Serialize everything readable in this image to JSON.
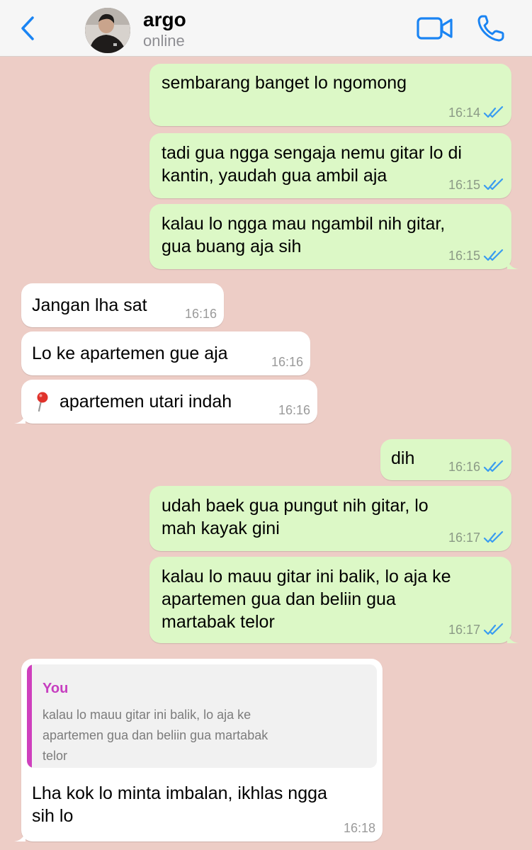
{
  "header": {
    "back_icon": "chevron-left-icon",
    "contact_name": "argo",
    "contact_status": "online",
    "video_icon": "video-camera-icon",
    "call_icon": "phone-icon",
    "accent_color": "#1a84f3"
  },
  "messages": [
    {
      "direction": "outgoing",
      "lines": [
        "sembarang banget lo ngomong"
      ],
      "time": "16:14",
      "status": "read"
    },
    {
      "direction": "outgoing",
      "lines": [
        "tadi gua ngga sengaja nemu gitar lo di",
        "kantin, yaudah gua ambil aja"
      ],
      "time": "16:15",
      "status": "read"
    },
    {
      "direction": "outgoing",
      "lines": [
        "kalau lo ngga mau ngambil nih gitar,",
        "gua buang aja sih"
      ],
      "time": "16:15",
      "status": "read"
    },
    {
      "direction": "incoming",
      "lines": [
        "Jangan lha sat"
      ],
      "time": "16:16"
    },
    {
      "direction": "incoming",
      "lines": [
        "Lo ke apartemen gue aja"
      ],
      "time": "16:16"
    },
    {
      "direction": "incoming",
      "icon": "location-pin-icon",
      "lines": [
        "apartemen utari indah"
      ],
      "time": "16:16"
    },
    {
      "direction": "outgoing",
      "lines": [
        "dih"
      ],
      "time": "16:16",
      "status": "read"
    },
    {
      "direction": "outgoing",
      "lines": [
        "udah baek gua pungut nih gitar, lo",
        "mah kayak gini"
      ],
      "time": "16:17",
      "status": "read"
    },
    {
      "direction": "outgoing",
      "lines": [
        "kalau lo mauu gitar ini balik, lo aja ke",
        "apartemen gua dan beliin gua",
        "martabak telor"
      ],
      "time": "16:17",
      "status": "read"
    },
    {
      "direction": "incoming",
      "quote": {
        "author": "You",
        "lines": [
          "kalau lo mauu gitar ini balik, lo aja ke",
          "apartemen gua dan beliin gua martabak",
          "telor"
        ]
      },
      "lines": [
        "Lha kok lo minta imbalan, ikhlas ngga",
        "sih lo"
      ],
      "time": "16:18"
    }
  ],
  "colors": {
    "background": "#edcdc6",
    "outgoing_bubble": "#dcf8c6",
    "incoming_bubble": "#ffffff",
    "read_ticks": "#3a9cf0",
    "quote_accent": "#c73fc0"
  }
}
